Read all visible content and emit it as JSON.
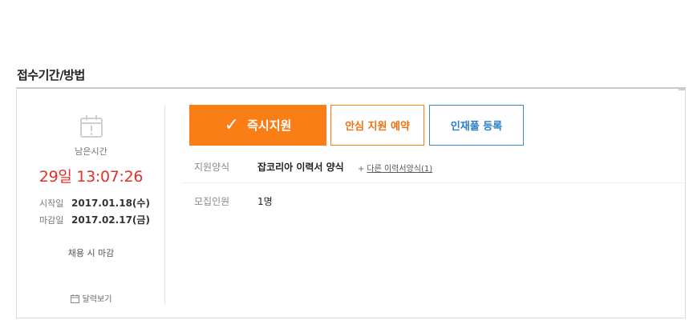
{
  "section": {
    "title": "접수기간/방법"
  },
  "deadline": {
    "remaining_label": "남은시간",
    "countdown": "29일 13:07:26",
    "start_label": "시작일",
    "start_date": "2017.01.18(수)",
    "end_label": "마감일",
    "end_date": "2017.02.17(금)",
    "close_note": "채용 시 마감",
    "calendar_link": "달력보기"
  },
  "buttons": {
    "apply": "즉시지원",
    "reserve": "안심 지원 예약",
    "register": "인재풀 등록"
  },
  "info": {
    "method_label": "지원양식",
    "method_value": "잡코리아 이력서 양식",
    "other_forms_link": "다른 이력서양식(1)",
    "headcount_label": "모집인원",
    "headcount_value": "1명"
  },
  "colors": {
    "accent": "#f97e16",
    "countdown": "#e0312c",
    "blue": "#2a7cc7"
  }
}
